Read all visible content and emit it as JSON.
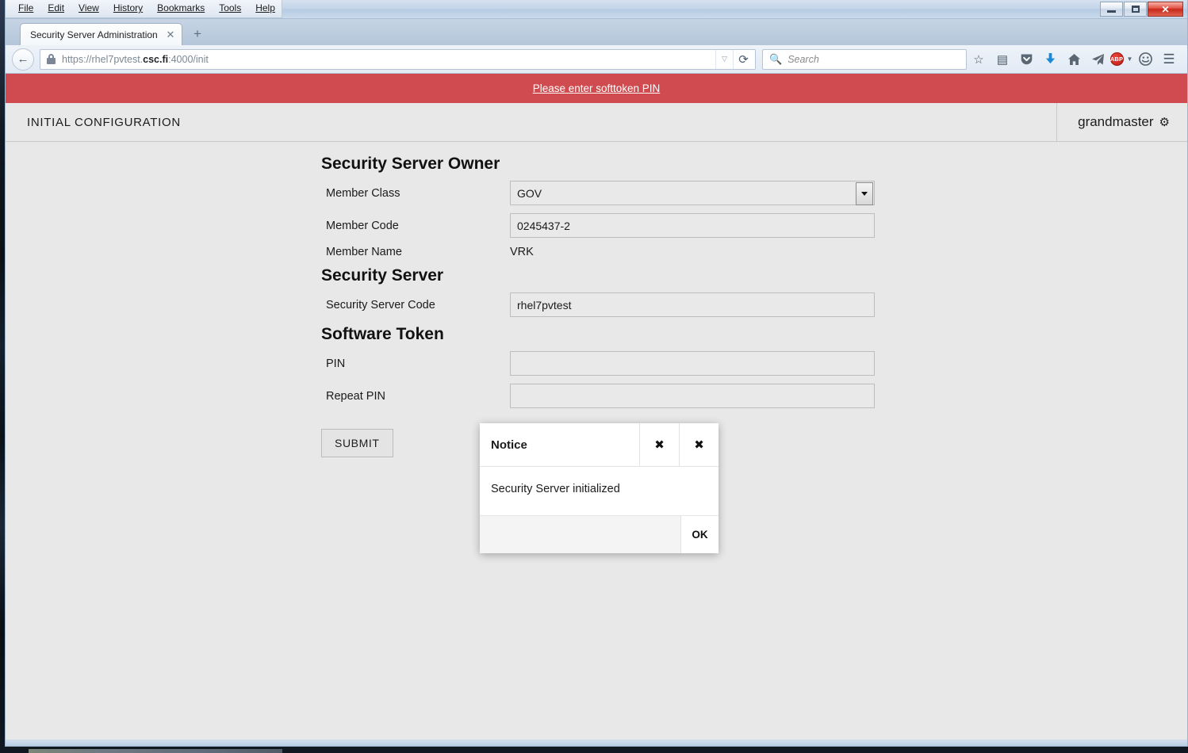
{
  "window": {
    "controls": {
      "minimize": "–",
      "maximize": "□",
      "close": "✕"
    },
    "menu": [
      "File",
      "Edit",
      "View",
      "History",
      "Bookmarks",
      "Tools",
      "Help"
    ]
  },
  "browser": {
    "tab": {
      "title": "Security Server Administration",
      "close": "✕"
    },
    "new_tab": "+",
    "back": "←",
    "url": {
      "scheme": "https://rhel7pvtest.",
      "domain": "csc.fi",
      "rest": ":4000/init"
    },
    "url_full": "https://rhel7pvtest.csc.fi:4000/init",
    "url_dropdown": "▽",
    "reload": "⟳",
    "search": {
      "placeholder": "Search",
      "icon": "search-icon"
    },
    "toolbar_icons": [
      {
        "name": "bookmark-star-icon",
        "glyph": "☆"
      },
      {
        "name": "reading-list-icon",
        "glyph": "▤"
      },
      {
        "name": "pocket-icon",
        "glyph": "🛡"
      },
      {
        "name": "downloads-icon",
        "glyph": "⬇"
      },
      {
        "name": "home-icon",
        "glyph": "⌂"
      },
      {
        "name": "send-tab-icon",
        "glyph": "➤"
      },
      {
        "name": "adblock-plus-icon",
        "glyph": "ABP"
      },
      {
        "name": "feedback-smiley-icon",
        "glyph": "☻"
      },
      {
        "name": "hamburger-menu-icon",
        "glyph": "☰"
      }
    ]
  },
  "page": {
    "alert": {
      "text": "Please enter softtoken PIN",
      "color": "#cf4b4f"
    },
    "header": {
      "title": "INITIAL CONFIGURATION",
      "user": "grandmaster",
      "gear": "⚙"
    },
    "sections": [
      {
        "heading": "Security Server Owner",
        "fields": [
          {
            "label": "Member Class",
            "value": "GOV",
            "type": "select"
          },
          {
            "label": "Member Code",
            "value": "0245437-2",
            "type": "text"
          },
          {
            "label": "Member Name",
            "value": "VRK",
            "type": "static"
          }
        ]
      },
      {
        "heading": "Security Server",
        "fields": [
          {
            "label": "Security Server Code",
            "value": "rhel7pvtest",
            "type": "text"
          }
        ]
      },
      {
        "heading": "Software Token",
        "fields": [
          {
            "label": "PIN",
            "value": "",
            "type": "password"
          },
          {
            "label": "Repeat PIN",
            "value": "",
            "type": "password"
          }
        ]
      }
    ],
    "submit": "SUBMIT"
  },
  "modal": {
    "title": "Notice",
    "message": "Security Server initialized",
    "close_all": "✖",
    "close": "✖",
    "ok": "OK"
  }
}
